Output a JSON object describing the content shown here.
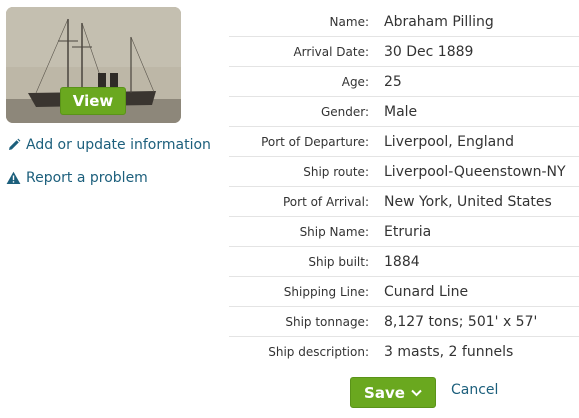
{
  "thumbnail": {
    "view_label": "View"
  },
  "sidebar": {
    "edit_label": "Add or update information",
    "report_label": "Report a problem"
  },
  "details": [
    {
      "label": "Name:",
      "value": "Abraham Pilling"
    },
    {
      "label": "Arrival Date:",
      "value": "30 Dec 1889"
    },
    {
      "label": "Age:",
      "value": "25"
    },
    {
      "label": "Gender:",
      "value": "Male"
    },
    {
      "label": "Port of Departure:",
      "value": "Liverpool, England"
    },
    {
      "label": "Ship route:",
      "value": "Liverpool-Queenstown-NY"
    },
    {
      "label": "Port of Arrival:",
      "value": "New York, United States"
    },
    {
      "label": "Ship Name:",
      "value": "Etruria"
    },
    {
      "label": "Ship built:",
      "value": "1884"
    },
    {
      "label": "Shipping Line:",
      "value": "Cunard Line"
    },
    {
      "label": "Ship tonnage:",
      "value": "8,127 tons; 501' x 57'"
    },
    {
      "label": "Ship description:",
      "value": "3 masts, 2 funnels"
    }
  ],
  "actions": {
    "save_label": "Save",
    "cancel_label": "Cancel"
  },
  "colors": {
    "accent_green": "#6aa81f",
    "link_blue": "#1c5f7c",
    "text": "#333333",
    "divider": "#e4e4e4"
  },
  "icons": {
    "edit": "pencil-icon",
    "report": "warning-icon",
    "save_menu": "chevron-down-icon"
  }
}
